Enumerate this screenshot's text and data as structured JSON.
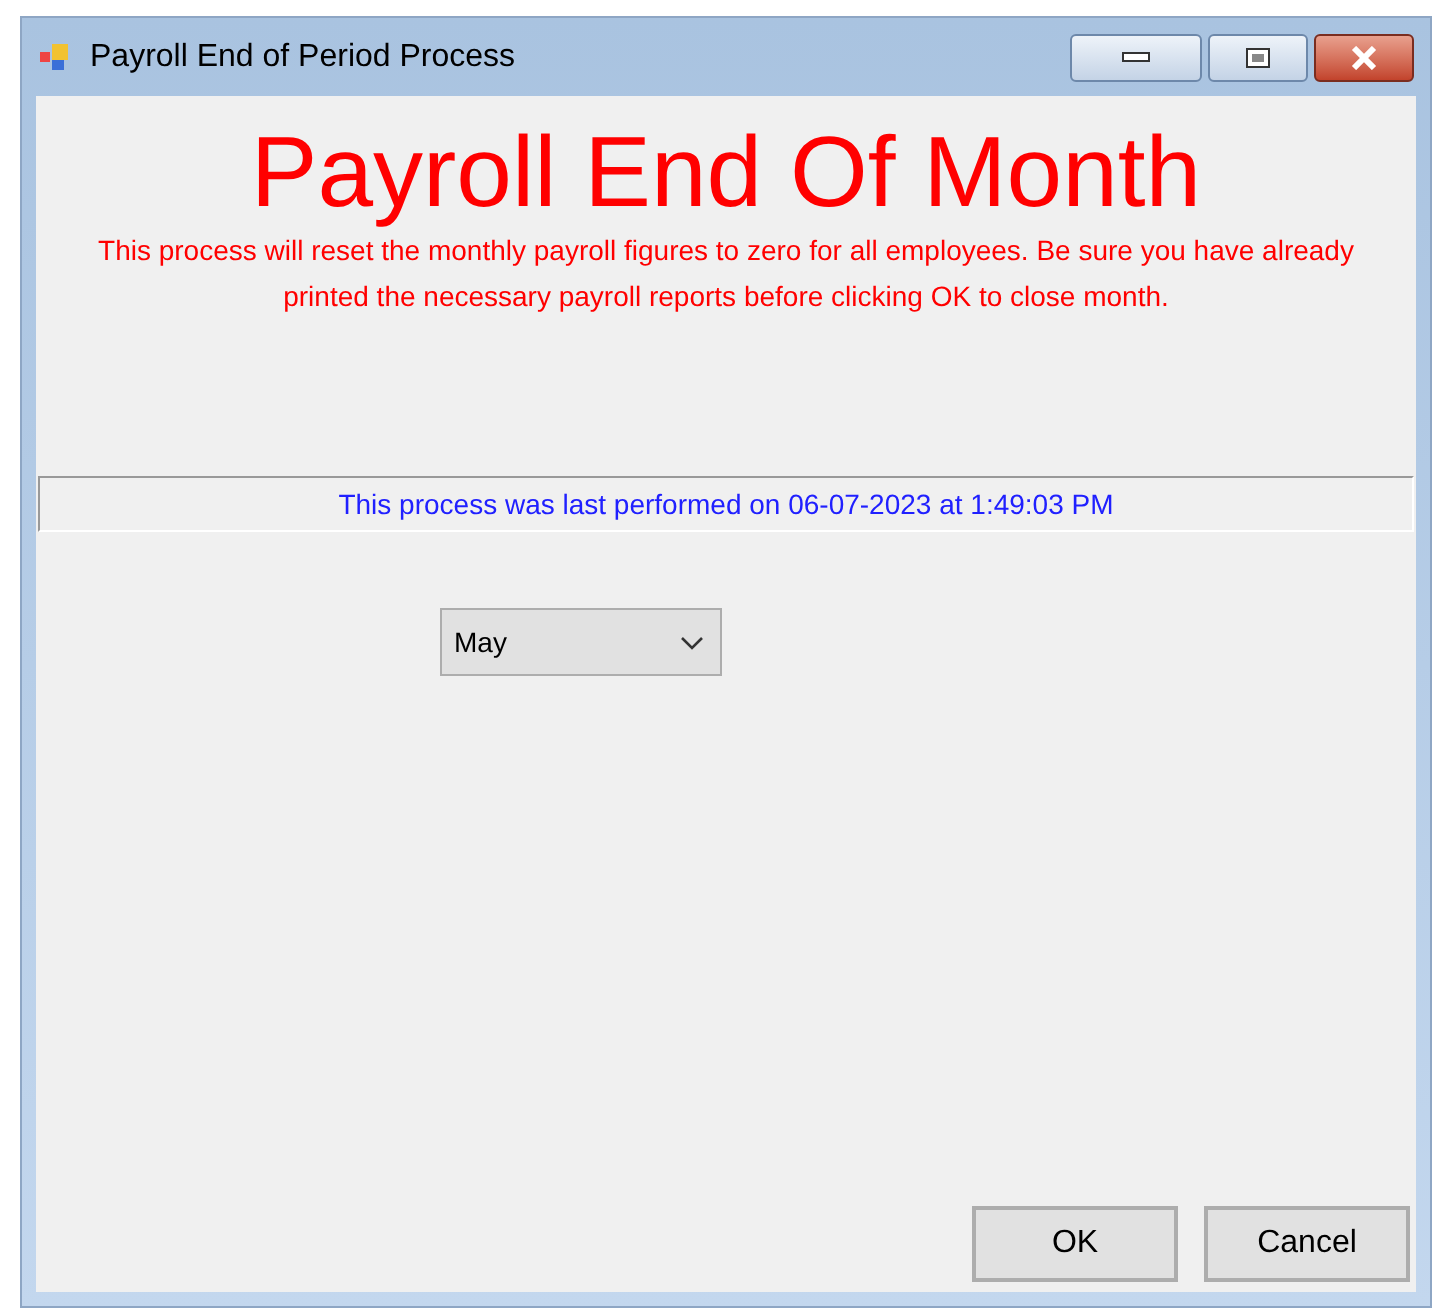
{
  "window": {
    "title": "Payroll End of Period Process"
  },
  "heading": "Payroll End Of Month",
  "warning": "This process will reset the monthly payroll figures to zero for all employees.  Be sure you have already printed the necessary payroll reports before clicking OK to close month.",
  "last_performed": "This process was last performed on 06-07-2023 at 1:49:03 PM",
  "month_select": {
    "value": "May"
  },
  "buttons": [
    "OK",
    "Cancel"
  ]
}
